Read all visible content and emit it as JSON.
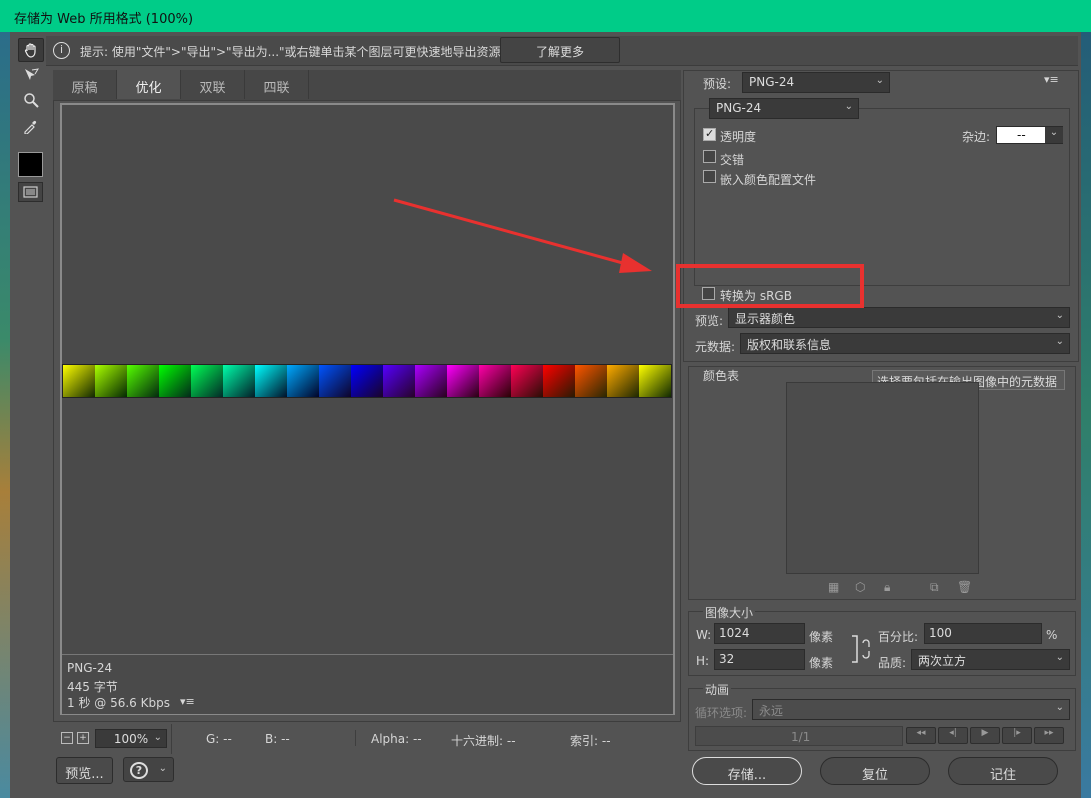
{
  "window": {
    "title": "存储为 Web 所用格式 (100%)"
  },
  "tools": {
    "hand": "hand-icon",
    "slice": "slice-select-icon",
    "zoom": "zoom-icon",
    "eyedropper": "eyedropper-icon"
  },
  "infobar": {
    "icon": "info-icon",
    "tip": "提示: 使用\"文件\">\"导出\">\"导出为...\"或右键单击某个图层可更快速地导出资源",
    "learn_more": "了解更多"
  },
  "tabs": [
    {
      "label": "原稿"
    },
    {
      "label": "优化"
    },
    {
      "label": "双联"
    },
    {
      "label": "四联"
    }
  ],
  "preview": {
    "format": "PNG-24",
    "size": "445 字节",
    "time": "1 秒 @ 56.6 Kbps",
    "menu_icon": "▾≡"
  },
  "statusbar": {
    "zoom": "100%",
    "g": "G: --",
    "b": "B: --",
    "alpha": "Alpha: --",
    "hex": "十六进制: --",
    "index": "索引: --"
  },
  "bottom_left": {
    "preview_btn": "预览..."
  },
  "settings": {
    "preset_label": "预设:",
    "preset_value": "PNG-24",
    "format_value": "PNG-24",
    "transparency": "透明度",
    "transparency_checked": true,
    "interlace": "交错",
    "interlace_checked": false,
    "embed_profile": "嵌入颜色配置文件",
    "embed_checked": false,
    "matte_label": "杂边:",
    "matte_value": "--",
    "convert_srgb": "转换为 sRGB",
    "convert_checked": false,
    "preview_label": "预览:",
    "preview_value": "显示器颜色",
    "metadata_label": "元数据:",
    "metadata_value": "版权和联系信息",
    "tooltip": "选择要包括在输出图像中的元数据"
  },
  "color_table": {
    "title": "颜色表"
  },
  "image_size": {
    "title": "图像大小",
    "w_label": "W:",
    "w_value": "1024",
    "h_label": "H:",
    "h_value": "32",
    "unit": "像素",
    "percent_label": "百分比:",
    "percent_value": "100",
    "percent_unit": "%",
    "quality_label": "品质:",
    "quality_value": "两次立方"
  },
  "animation": {
    "title": "动画",
    "loop_label": "循环选项:",
    "loop_value": "永远",
    "frame": "1/1"
  },
  "buttons": {
    "save": "存储...",
    "reset": "复位",
    "remember": "记住"
  },
  "colors": {
    "accent_titlebar": "#00cc88",
    "highlight_box": "#e8312f",
    "arrow": "#e8312f"
  }
}
